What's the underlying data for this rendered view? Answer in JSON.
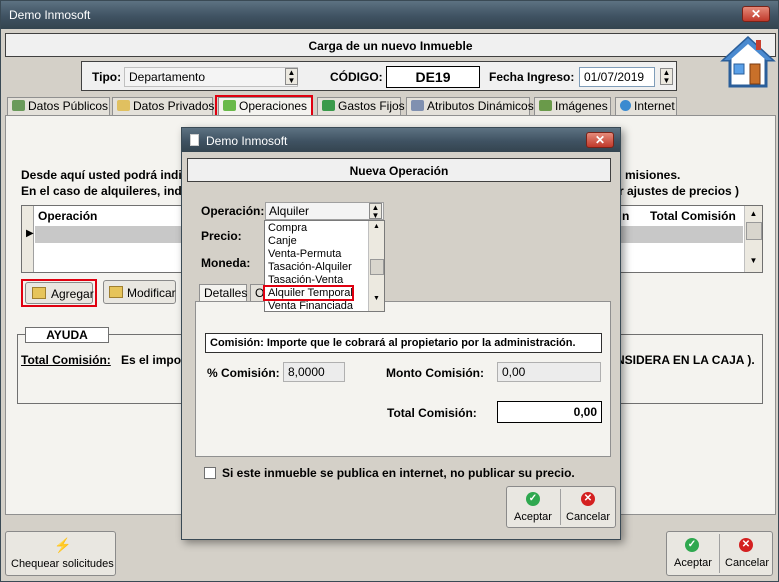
{
  "window": {
    "title": "Demo Inmosoft"
  },
  "header": {
    "title": "Carga de un nuevo Inmueble",
    "tipo_label": "Tipo:",
    "tipo_value": "Departamento",
    "codigo_label": "CÓDIGO:",
    "codigo_value": "DE19",
    "fecha_label": "Fecha Ingreso:",
    "fecha_value": "01/07/2019"
  },
  "tabs": [
    {
      "label": "Datos Públicos"
    },
    {
      "label": "Datos Privados"
    },
    {
      "label": "Operaciones"
    },
    {
      "label": "Gastos Fijos"
    },
    {
      "label": "Atributos Dinámicos"
    },
    {
      "label": "Imágenes"
    },
    {
      "label": "Internet"
    }
  ],
  "main": {
    "desc_line1": "Desde aquí usted podrá indi",
    "desc_line1_right": "misiones.",
    "desc_line2": "En el caso de alquileres, ind",
    "desc_line2_right": "r ajustes de precios )",
    "grid_col_operacion": "Operación",
    "grid_col_n": "n",
    "grid_col_total": "Total Comisión",
    "btn_agregar": "Agregar",
    "btn_modificar": "Modificar",
    "ayuda_title": "AYUDA",
    "ayuda_term": "Total Comisión:",
    "ayuda_text_left": "Es el impor",
    "ayuda_text_right": "NSIDERA EN LA CAJA )."
  },
  "footer": {
    "btn_chequear": "Chequear solicitudes",
    "btn_aceptar": "Aceptar",
    "btn_cancelar": "Cancelar"
  },
  "dialog": {
    "title": "Demo Inmosoft",
    "heading": "Nueva Operación",
    "operacion_label": "Operación:",
    "operacion_value": "Alquiler",
    "precio_label": "Precio:",
    "moneda_label": "Moneda:",
    "dropdown_options": [
      "Compra",
      "Canje",
      "Venta-Permuta",
      "Tasación-Alquiler",
      "Tasación-Venta",
      "Alquiler Temporal",
      "Venta Financiada"
    ],
    "tab_detalles": "Detalles",
    "tab_second": "O",
    "comision_info": "Comisión: Importe que le cobrará al propietario por la administración.",
    "pct_label": "% Comisión:",
    "pct_value": "8,0000",
    "monto_label": "Monto Comisión:",
    "monto_value": "0,00",
    "total_label": "Total Comisión:",
    "total_value": "0,00",
    "checkbox_label": "Si este inmueble se publica en internet, no publicar su precio.",
    "btn_aceptar": "Aceptar",
    "btn_cancelar": "Cancelar"
  },
  "colors": {
    "highlight": "#e00010",
    "accept": "#2fa84f",
    "cancel": "#d42020",
    "selected_row": "#c8c8c8"
  }
}
